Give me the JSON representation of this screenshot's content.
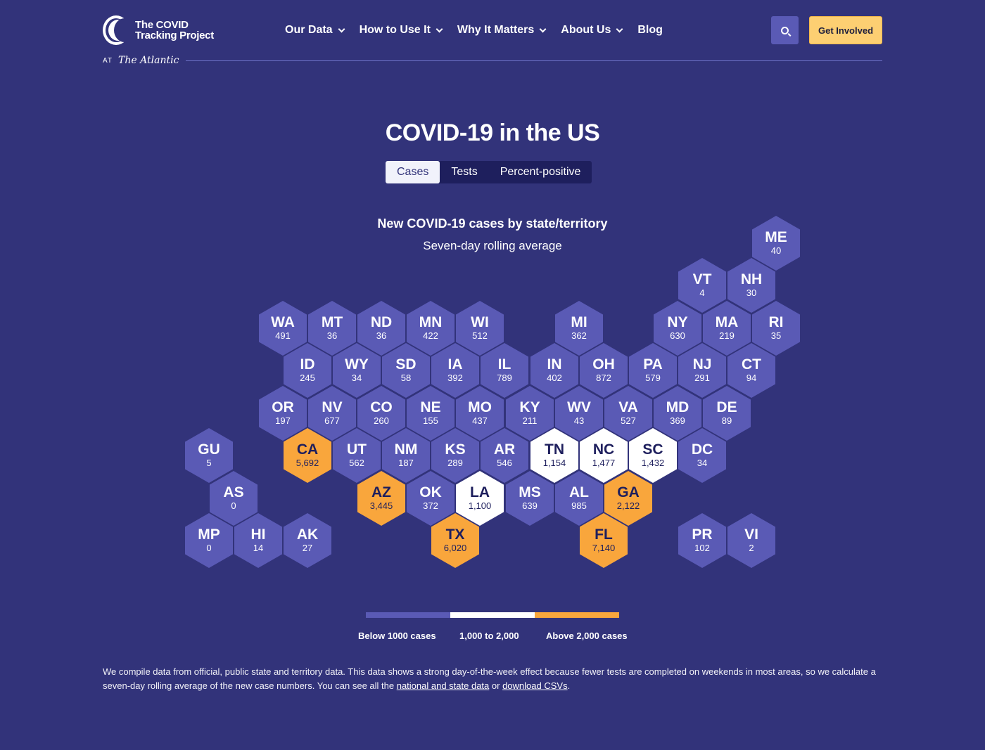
{
  "header": {
    "logo_text": "The COVID Tracking Project",
    "at_label": "AT",
    "partner": "The Atlantic",
    "nav": [
      {
        "label": "Our Data"
      },
      {
        "label": "How to Use It"
      },
      {
        "label": "Why It Matters"
      },
      {
        "label": "About Us"
      },
      {
        "label": "Blog"
      }
    ],
    "cta_label": "Get Involved",
    "search_icon": "search-icon"
  },
  "page": {
    "title": "COVID-19 in the US",
    "tabs": [
      {
        "label": "Cases",
        "active": true
      },
      {
        "label": "Tests",
        "active": false
      },
      {
        "label": "Percent-positive",
        "active": false
      }
    ]
  },
  "map": {
    "title": "New COVID-19 cases by state/territory",
    "subtitle": "Seven-day rolling average",
    "colors": {
      "low": "#5a5ab5",
      "mid": "#ffffff",
      "high": "#f9a63c"
    },
    "states": [
      {
        "abbr": "ME",
        "value": "40"
      },
      {
        "abbr": "VT",
        "value": "4"
      },
      {
        "abbr": "NH",
        "value": "30"
      },
      {
        "abbr": "WA",
        "value": "491"
      },
      {
        "abbr": "MT",
        "value": "36"
      },
      {
        "abbr": "ND",
        "value": "36"
      },
      {
        "abbr": "MN",
        "value": "422"
      },
      {
        "abbr": "WI",
        "value": "512"
      },
      {
        "abbr": "MI",
        "value": "362"
      },
      {
        "abbr": "NY",
        "value": "630"
      },
      {
        "abbr": "MA",
        "value": "219"
      },
      {
        "abbr": "RI",
        "value": "35"
      },
      {
        "abbr": "ID",
        "value": "245"
      },
      {
        "abbr": "WY",
        "value": "34"
      },
      {
        "abbr": "SD",
        "value": "58"
      },
      {
        "abbr": "IA",
        "value": "392"
      },
      {
        "abbr": "IL",
        "value": "789"
      },
      {
        "abbr": "IN",
        "value": "402"
      },
      {
        "abbr": "OH",
        "value": "872"
      },
      {
        "abbr": "PA",
        "value": "579"
      },
      {
        "abbr": "NJ",
        "value": "291"
      },
      {
        "abbr": "CT",
        "value": "94"
      },
      {
        "abbr": "OR",
        "value": "197"
      },
      {
        "abbr": "NV",
        "value": "677"
      },
      {
        "abbr": "CO",
        "value": "260"
      },
      {
        "abbr": "NE",
        "value": "155"
      },
      {
        "abbr": "MO",
        "value": "437"
      },
      {
        "abbr": "KY",
        "value": "211"
      },
      {
        "abbr": "WV",
        "value": "43"
      },
      {
        "abbr": "VA",
        "value": "527"
      },
      {
        "abbr": "MD",
        "value": "369"
      },
      {
        "abbr": "DE",
        "value": "89"
      },
      {
        "abbr": "GU",
        "value": "5"
      },
      {
        "abbr": "CA",
        "value": "5,692"
      },
      {
        "abbr": "UT",
        "value": "562"
      },
      {
        "abbr": "NM",
        "value": "187"
      },
      {
        "abbr": "KS",
        "value": "289"
      },
      {
        "abbr": "AR",
        "value": "546"
      },
      {
        "abbr": "TN",
        "value": "1,154"
      },
      {
        "abbr": "NC",
        "value": "1,477"
      },
      {
        "abbr": "SC",
        "value": "1,432"
      },
      {
        "abbr": "DC",
        "value": "34"
      },
      {
        "abbr": "AS",
        "value": "0"
      },
      {
        "abbr": "AZ",
        "value": "3,445"
      },
      {
        "abbr": "OK",
        "value": "372"
      },
      {
        "abbr": "LA",
        "value": "1,100"
      },
      {
        "abbr": "MS",
        "value": "639"
      },
      {
        "abbr": "AL",
        "value": "985"
      },
      {
        "abbr": "GA",
        "value": "2,122"
      },
      {
        "abbr": "MP",
        "value": "0"
      },
      {
        "abbr": "HI",
        "value": "14"
      },
      {
        "abbr": "AK",
        "value": "27"
      },
      {
        "abbr": "TX",
        "value": "6,020"
      },
      {
        "abbr": "FL",
        "value": "7,140"
      },
      {
        "abbr": "PR",
        "value": "102"
      },
      {
        "abbr": "VI",
        "value": "2"
      }
    ],
    "legend": [
      {
        "label": "Below 1000 cases",
        "color": "#5a5ab5"
      },
      {
        "label": "1,000 to 2,000",
        "color": "#ffffff"
      },
      {
        "label": "Above 2,000 cases",
        "color": "#f9a63c"
      }
    ]
  },
  "footnote": {
    "text": "We compile data from official, public state and territory data. This data shows a strong day-of-the-week effect because fewer tests are completed on weekends in most areas, so we calculate a seven-day rolling average of the new case numbers. You can see all the ",
    "link1": "national and state data",
    "middle": " or ",
    "link2": "download CSVs",
    "end": "."
  }
}
